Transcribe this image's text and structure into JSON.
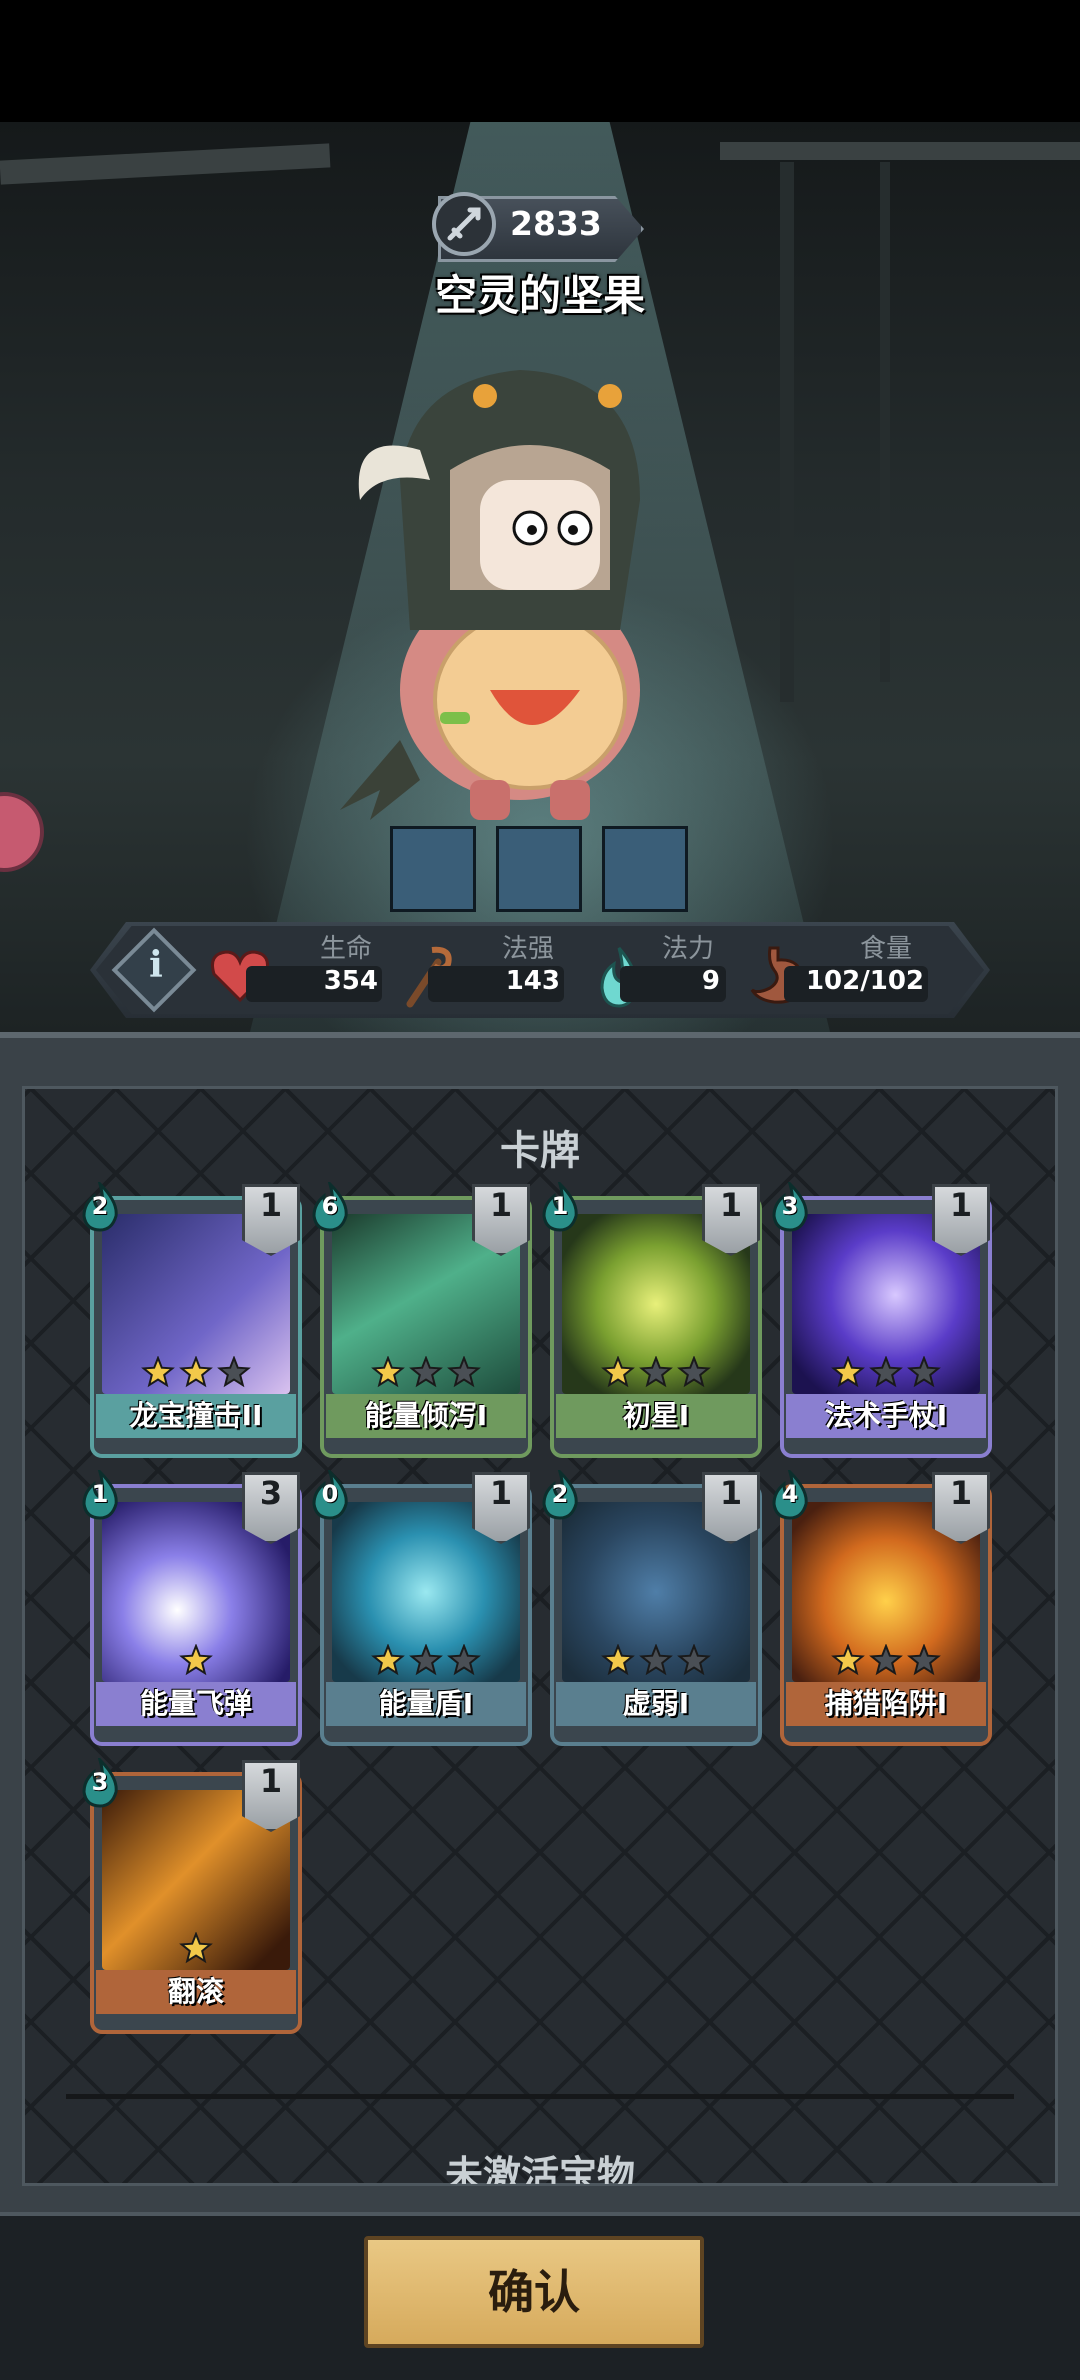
{
  "character": {
    "name": "空灵的坚果",
    "score": "2833"
  },
  "stats": {
    "health": {
      "label": "生命",
      "value": "354"
    },
    "spell_power": {
      "label": "法强",
      "value": "143"
    },
    "mana": {
      "label": "法力",
      "value": "9"
    },
    "food": {
      "label": "食量",
      "value": "102/102"
    }
  },
  "cards_section": {
    "title": "卡牌",
    "cards": [
      {
        "name": "龙宝撞击II",
        "cost": "2",
        "level": "1",
        "stars": 2,
        "max_stars": 3,
        "color": "#5aa0a0"
      },
      {
        "name": "能量倾泻I",
        "cost": "6",
        "level": "1",
        "stars": 1,
        "max_stars": 3,
        "color": "#6f9a5e"
      },
      {
        "name": "初星I",
        "cost": "1",
        "level": "1",
        "stars": 1,
        "max_stars": 3,
        "color": "#6f9a5e"
      },
      {
        "name": "法术手杖I",
        "cost": "3",
        "level": "1",
        "stars": 1,
        "max_stars": 3,
        "color": "#8a7fd0"
      },
      {
        "name": "能量飞弹",
        "cost": "1",
        "level": "3",
        "stars": 1,
        "max_stars": 1,
        "color": "#8a7fd0"
      },
      {
        "name": "能量盾I",
        "cost": "0",
        "level": "1",
        "stars": 1,
        "max_stars": 3,
        "color": "#5a7f8f"
      },
      {
        "name": "虚弱I",
        "cost": "2",
        "level": "1",
        "stars": 1,
        "max_stars": 3,
        "color": "#5a7f8f"
      },
      {
        "name": "捕猎陷阱I",
        "cost": "4",
        "level": "1",
        "stars": 1,
        "max_stars": 3,
        "color": "#b0653a"
      },
      {
        "name": "翻滚",
        "cost": "3",
        "level": "1",
        "stars": 1,
        "max_stars": 1,
        "color": "#b0653a"
      }
    ]
  },
  "next_section": {
    "title": "未激活宝物"
  },
  "confirm_label": "确认"
}
